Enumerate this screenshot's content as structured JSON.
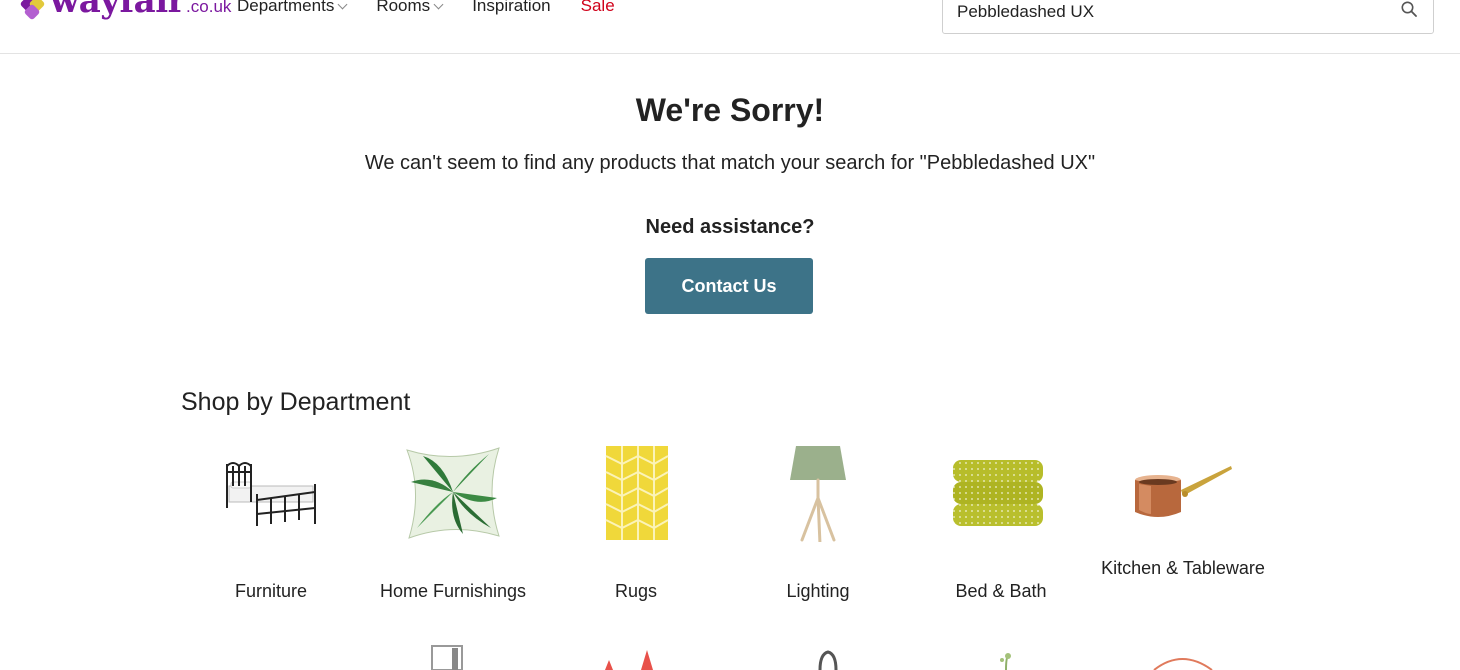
{
  "header": {
    "logo_word": "wayfair",
    "logo_tld": ".co.uk",
    "nav": [
      {
        "label": "Departments",
        "has_dropdown": true
      },
      {
        "label": "Rooms",
        "has_dropdown": true
      },
      {
        "label": "Inspiration",
        "has_dropdown": false
      },
      {
        "label": "Sale",
        "has_dropdown": false,
        "color": "#d0021b"
      }
    ],
    "search": {
      "value": "Pebbledashed UX",
      "icon": "search-icon"
    }
  },
  "main": {
    "title": "We're Sorry!",
    "message": "We can't seem to find any products that match your search for \"Pebbledashed UX\"",
    "assist": "Need assistance?",
    "contact_label": "Contact Us",
    "accent": "#3d7388"
  },
  "departments": {
    "heading": "Shop by Department",
    "items": [
      {
        "label": "Furniture",
        "icon": "bed-icon"
      },
      {
        "label": "Home Furnishings",
        "icon": "cushion-icon"
      },
      {
        "label": "Rugs",
        "icon": "rug-icon"
      },
      {
        "label": "Lighting",
        "icon": "lamp-icon"
      },
      {
        "label": "Bed & Bath",
        "icon": "towels-icon"
      },
      {
        "label": "Kitchen & Tableware",
        "icon": "saucepan-icon"
      }
    ]
  },
  "colors": {
    "brand": "#7b189f",
    "sale": "#d0021b",
    "button": "#3d7388"
  }
}
